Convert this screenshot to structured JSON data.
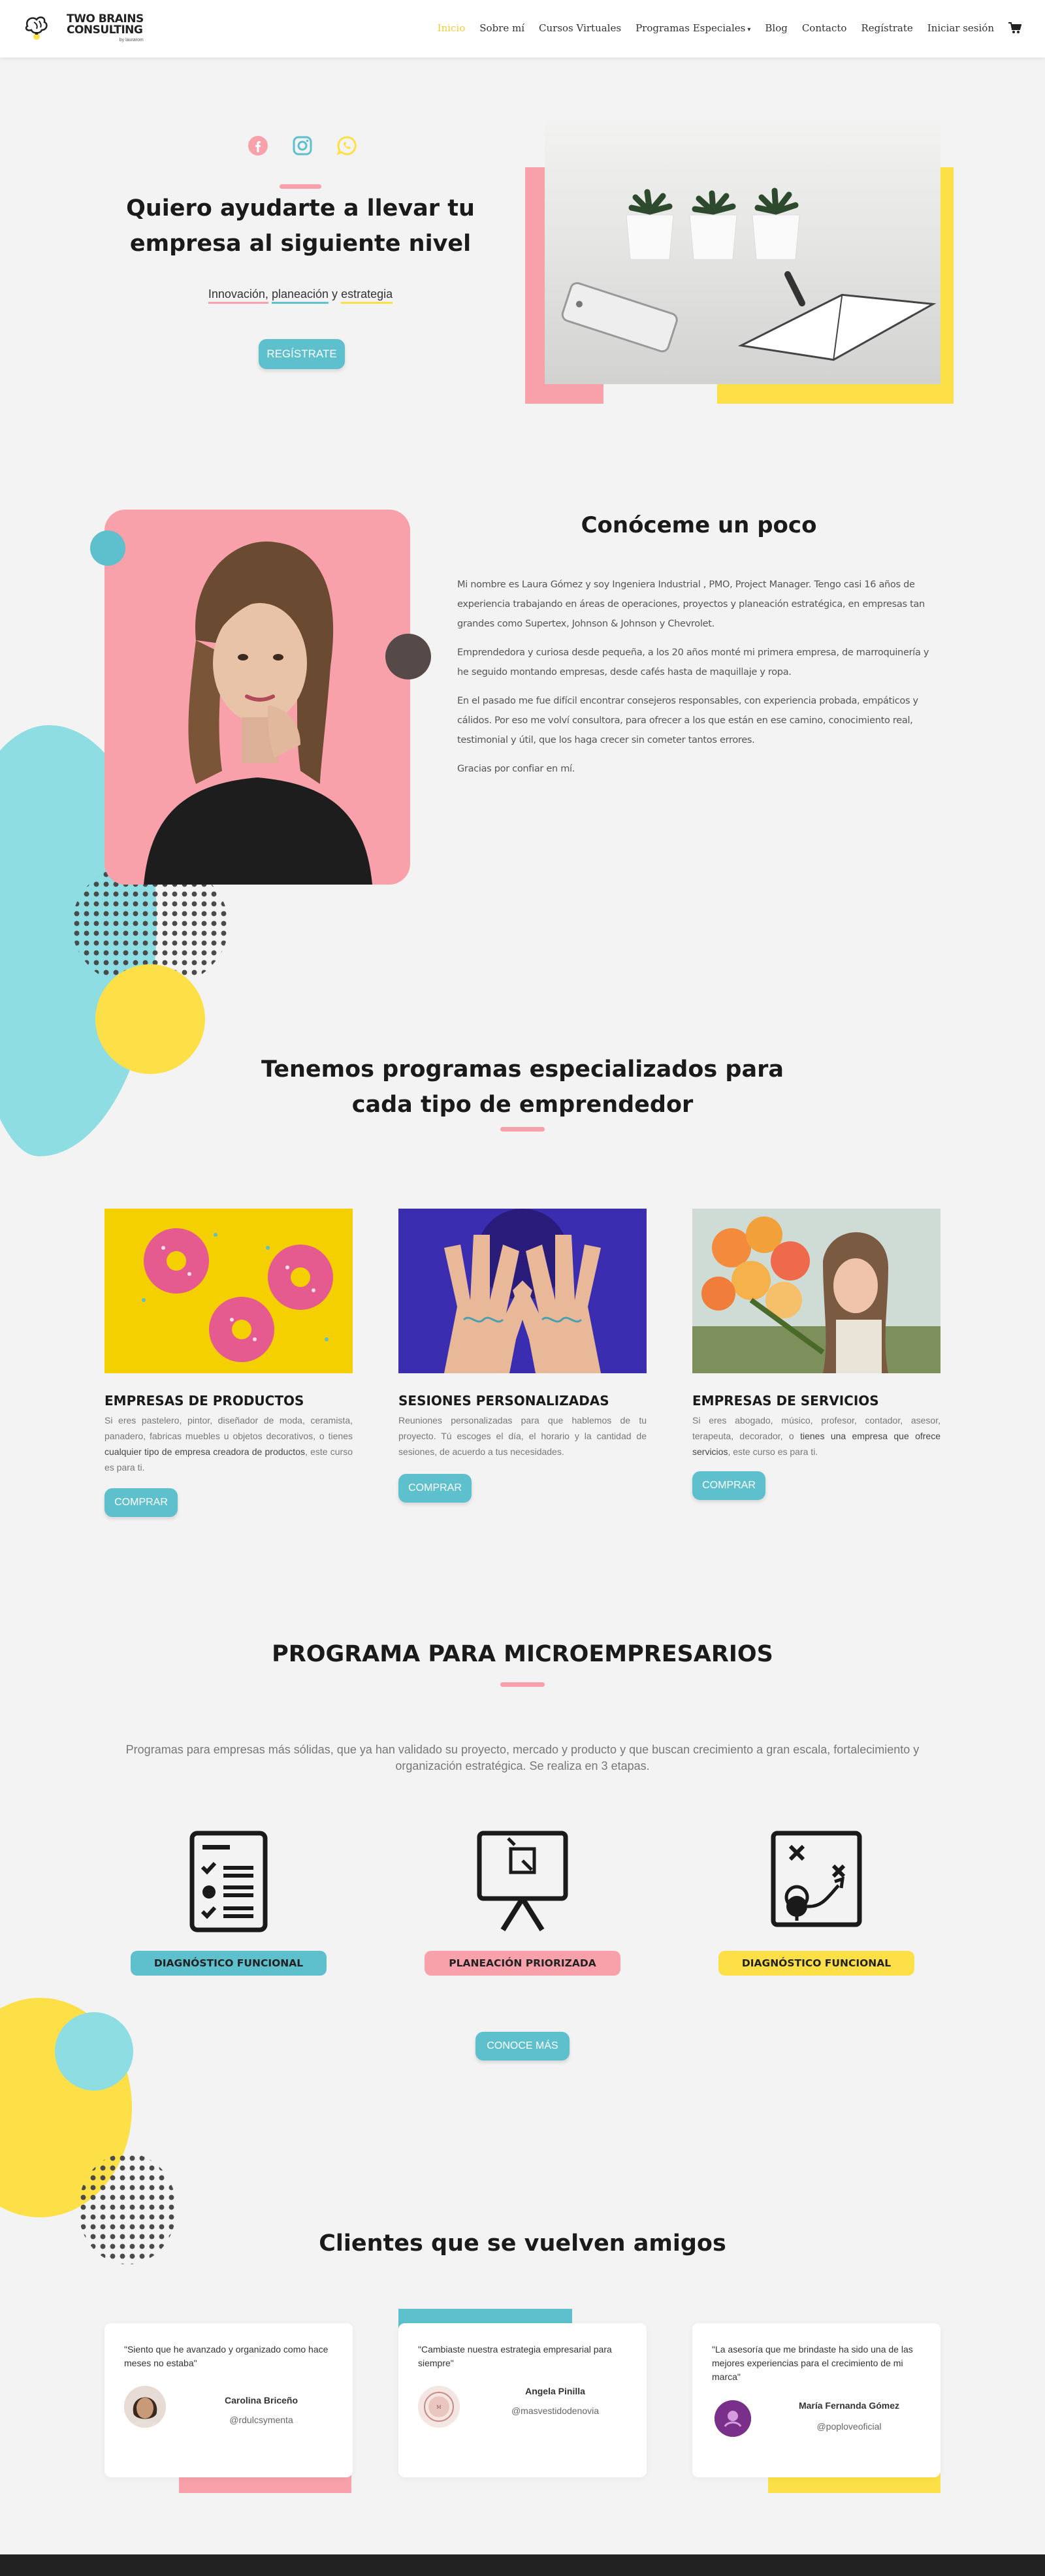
{
  "header": {
    "logo_line1": "TWO BRAINS",
    "logo_line2": "CONSULTING",
    "logo_sub": "by laurarom",
    "nav": [
      {
        "label": "Inicio"
      },
      {
        "label": "Sobre mí"
      },
      {
        "label": "Cursos Virtuales"
      },
      {
        "label": "Programas Especiales"
      },
      {
        "label": "Blog"
      },
      {
        "label": "Contacto"
      },
      {
        "label": "Regístrate"
      },
      {
        "label": "Iniciar sesión"
      }
    ],
    "active_color": "#f5cd3a"
  },
  "hero": {
    "social_icons": [
      "facebook-icon",
      "instagram-icon",
      "whatsapp-icon"
    ],
    "title": "Quiero ayudarte a llevar tu empresa al siguiente nivel",
    "tag_1": "Innovación,",
    "tag_2": "planeación",
    "tag_3": "y",
    "tag_4": "estrategia",
    "button": "REGÍSTRATE"
  },
  "about": {
    "title": "Conóceme un poco",
    "paragraphs": [
      "Mi nombre es Laura Gómez y soy Ingeniera Industrial , PMO, Project Manager. Tengo casi 16 años de experiencia trabajando en áreas de operaciones, proyectos y planeación estratégica, en empresas tan grandes como Supertex, Johnson & Johnson y Chevrolet.",
      "Emprendedora y curiosa desde pequeña, a los 20 años monté mi primera empresa, de marroquinería y he seguido montando empresas, desde cafés hasta de maquillaje y ropa.",
      "En el pasado me fue difícil encontrar consejeros responsables, con experiencia probada, empáticos y cálidos. Por eso me volví consultora, para ofrecer a los que están en ese camino, conocimiento real, testimonial y útil, que los haga crecer sin cometer tantos errores.",
      "Gracias por confiar en mí."
    ]
  },
  "programs": {
    "title": "Tenemos programas especializados para cada tipo de emprendedor",
    "items": [
      {
        "name": "EMPRESAS DE PRODUCTOS",
        "desc_plain": "Si eres pastelero, pintor, diseñador de moda, ceramista, panadero, fabricas muebles u objetos decorativos, o tienes ",
        "desc_strong": "cualquier tipo de empresa creadora de productos",
        "desc_end": ", este curso es para ti.",
        "button": "COMPRAR"
      },
      {
        "name": "SESIONES PERSONALIZADAS",
        "desc_plain": "Reuniones personalizadas para que hablemos de tu proyecto. Tú escoges el día, el horario y la cantidad de sesiones, de acuerdo a tus necesidades.",
        "desc_strong": "",
        "desc_end": "",
        "button": "COMPRAR"
      },
      {
        "name": "EMPRESAS DE SERVICIOS",
        "desc_plain": "Si eres abogado, músico, profesor, contador, asesor, terapeuta, decorador, o ",
        "desc_strong": "tienes una empresa que ofrece servicios",
        "desc_end": ", este curso es para ti.",
        "button": "COMPRAR"
      }
    ]
  },
  "micro": {
    "title": "PROGRAMA PARA MICROEMPRESARIOS",
    "description": "Programas para empresas más sólidas, que ya han validado su proyecto, mercado y producto y que buscan crecimiento a gran escala, fortalecimiento y organización estratégica. Se realiza en 3 etapas.",
    "stages": [
      {
        "label": "DIAGNÓSTICO FUNCIONAL",
        "icon": "checklist-icon",
        "color": "#5ebfcd"
      },
      {
        "label": "PLANEACIÓN PRIORIZADA",
        "icon": "presentation-board-icon",
        "color": "#f8a1ab"
      },
      {
        "label": "DIAGNÓSTICO FUNCIONAL",
        "icon": "strategy-map-icon",
        "color": "#fde047"
      }
    ],
    "button": "CONOCE MÁS"
  },
  "clients": {
    "title": "Clientes que se vuelven amigos",
    "testimonials": [
      {
        "quote": "\"Siento que he avanzado y organizado como hace meses no estaba\"",
        "name": "Carolina Briceño",
        "handle": "@rdulcsymenta"
      },
      {
        "quote": "\"Cambiaste nuestra estrategia empresarial para siempre\"",
        "name": "Angela Pinilla",
        "handle": "@masvestidodenovia"
      },
      {
        "quote": "\"La asesoría que me brindaste ha sido una de las mejores experiencias para el crecimiento de mi marca\"",
        "name": "María Fernanda Gómez",
        "handle": "@poploveoficial"
      }
    ]
  },
  "colors": {
    "pink": "#f8a1ab",
    "teal": "#5ebfcd",
    "light_teal": "#8ddde2",
    "yellow": "#fde047"
  }
}
